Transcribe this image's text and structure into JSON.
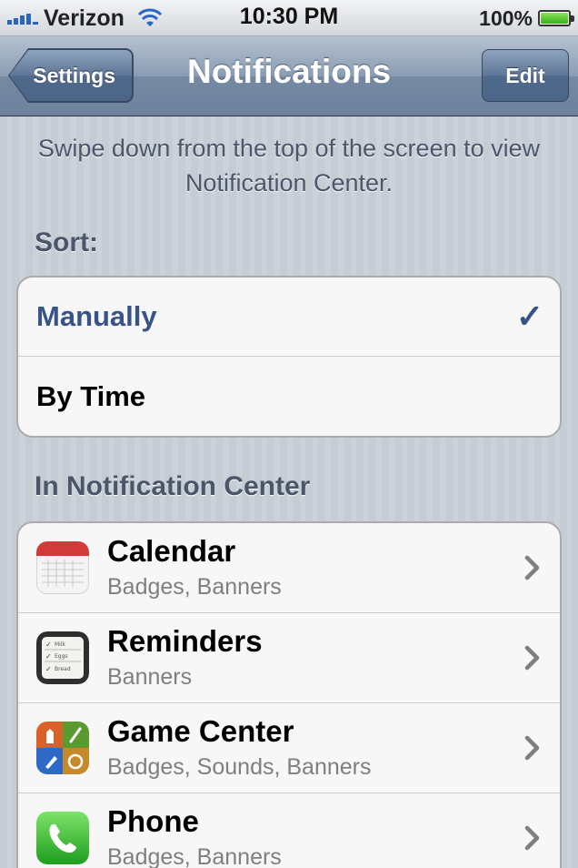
{
  "status_bar": {
    "carrier": "Verizon",
    "time": "10:30 PM",
    "battery": "100%",
    "icons": [
      "signal-icon",
      "wifi-icon",
      "battery-icon"
    ]
  },
  "nav": {
    "back_label": "Settings",
    "title": "Notifications",
    "edit_label": "Edit"
  },
  "hint_text": "Swipe down from the top of the screen to view Notification Center.",
  "sort": {
    "header": "Sort:",
    "options": [
      {
        "label": "Manually",
        "selected": true
      },
      {
        "label": "By Time",
        "selected": false
      }
    ]
  },
  "notification_center": {
    "header": "In Notification Center",
    "apps": [
      {
        "name": "Calendar",
        "alerts": "Badges, Banners",
        "icon": "calendar-icon"
      },
      {
        "name": "Reminders",
        "alerts": "Banners",
        "icon": "reminders-icon",
        "icon_list": [
          "Milk",
          "Eggs",
          "Bread"
        ]
      },
      {
        "name": "Game Center",
        "alerts": "Badges, Sounds, Banners",
        "icon": "game-center-icon"
      },
      {
        "name": "Phone",
        "alerts": "Badges, Banners",
        "icon": "phone-icon"
      }
    ]
  },
  "colors": {
    "nav_blue": "#6d829d",
    "selected_text": "#385487",
    "background": "#c5ccd4"
  }
}
